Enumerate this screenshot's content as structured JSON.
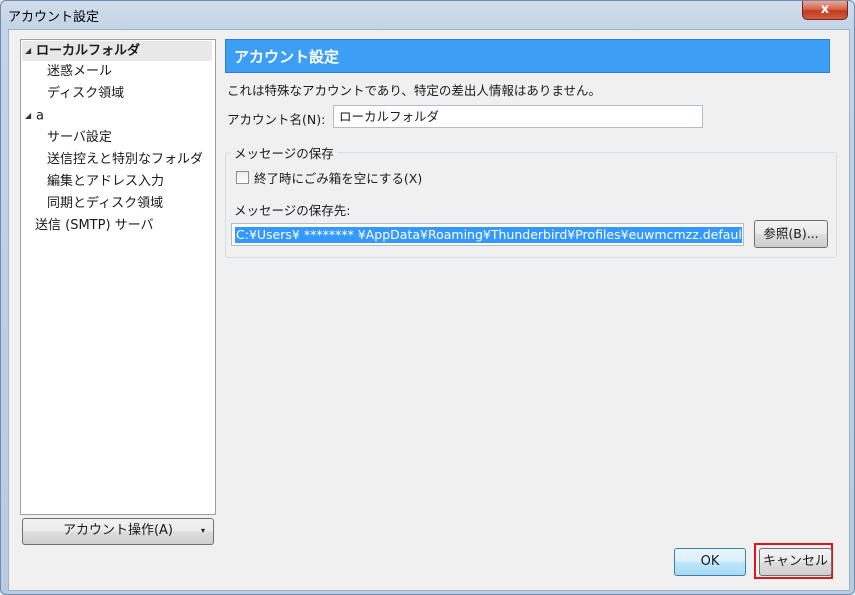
{
  "window": {
    "title": "アカウント設定",
    "close_glyph": "x"
  },
  "tree": {
    "items": [
      {
        "label": "ローカルフォルダ",
        "expand": "◢",
        "level": 0,
        "selected": true
      },
      {
        "label": "迷惑メール",
        "level": 1
      },
      {
        "label": "ディスク領域",
        "level": 1
      },
      {
        "label": "a",
        "expand": "◢",
        "level": 0
      },
      {
        "label": "サーバ設定",
        "level": 1
      },
      {
        "label": "送信控えと特別なフォルダ",
        "level": 1
      },
      {
        "label": "編集とアドレス入力",
        "level": 1
      },
      {
        "label": "同期とディスク領域",
        "level": 1
      },
      {
        "label": "送信 (SMTP) サーバ",
        "level": 0
      }
    ]
  },
  "account_actions": {
    "label": "アカウント操作(A)",
    "caret": "▾"
  },
  "panel": {
    "title": "アカウント設定",
    "info": "これは特殊なアカウントであり、特定の差出人情報はありません。",
    "account_name_label": "アカウント名(N):",
    "account_name_value": "ローカルフォルダ",
    "group_title": "メッセージの保存",
    "empty_trash_label": "終了時にごみ箱を空にする(X)",
    "empty_trash_checked": false,
    "store_path_label": "メッセージの保存先:",
    "store_path_value": "C:¥Users¥ ******** ¥AppData¥Roaming¥Thunderbird¥Profiles¥euwmcmzz.default¥Mail¥",
    "browse_label": "参照(B)..."
  },
  "buttons": {
    "ok": "OK",
    "cancel": "キャンセル"
  },
  "colors": {
    "header_blue": "#3c9ff5",
    "selection_blue": "#3399ff",
    "highlight_red": "#e2141b"
  }
}
